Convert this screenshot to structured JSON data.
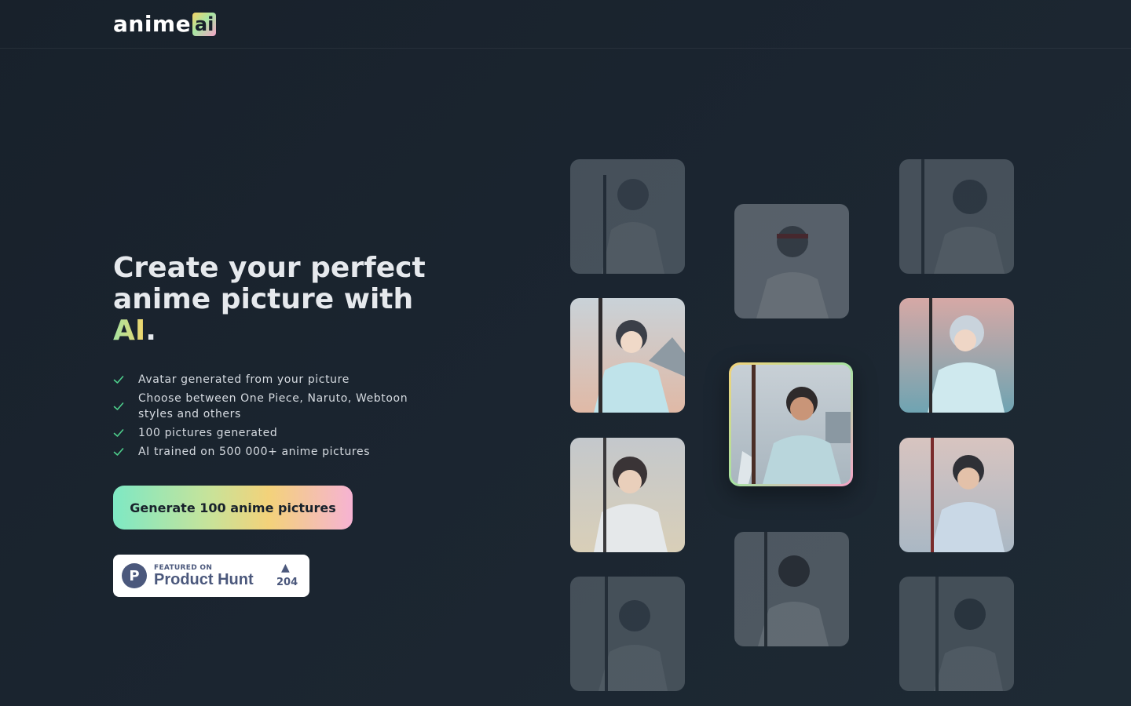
{
  "header": {
    "logo_word": "anime",
    "logo_badge": "ai"
  },
  "hero": {
    "title_line": "Create your perfect anime picture with",
    "title_ai": "AI",
    "title_end": "."
  },
  "features": [
    "Avatar generated from your picture",
    "Choose between One Piece, Naruto, Webtoon styles and others",
    "100 pictures generated",
    "AI trained on 500 000+ anime pictures"
  ],
  "cta": {
    "label": "Generate 100 anime pictures"
  },
  "product_hunt": {
    "small": "FEATURED ON",
    "big": "Product Hunt",
    "logo_letter": "P",
    "arrow": "▲",
    "count": "204"
  },
  "gallery": {
    "icon": "anime-avatar-image",
    "colors": {
      "accent_green": "#a6e3a1",
      "accent_yellow": "#f3d66b",
      "accent_pink": "#f6a3c7",
      "background": "#1b2530"
    }
  }
}
